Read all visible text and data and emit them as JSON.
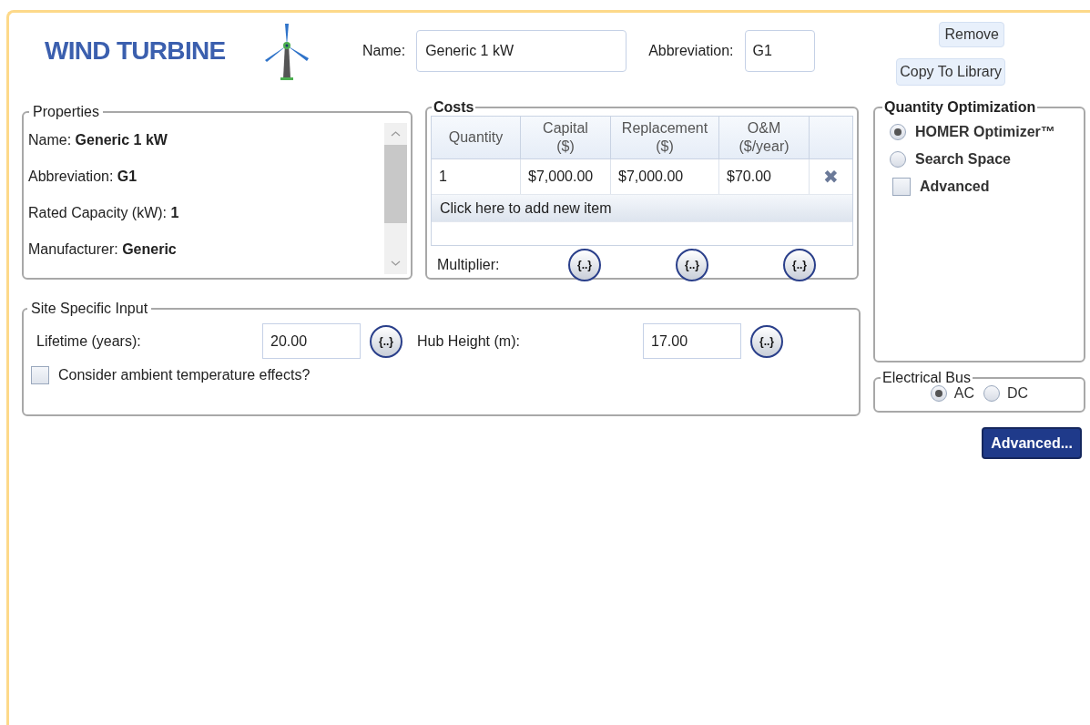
{
  "header": {
    "title": "WIND TURBINE",
    "name_label": "Name:",
    "name_value": "Generic 1 kW",
    "abbreviation_label": "Abbreviation:",
    "abbreviation_value": "G1"
  },
  "actions": {
    "remove": "Remove",
    "copy": "Copy To Library"
  },
  "properties": {
    "title": "Properties",
    "items": [
      "Name: **Generic 1 kW**",
      "Abbreviation: **G1**",
      "Rated Capacity (kW): **1**",
      "Manufacturer: **Generic**"
    ]
  },
  "costs": {
    "title": "Costs",
    "columns": [
      "Quantity",
      "Capital\n($)",
      "Replacement\n($)",
      "O&M\n($/year)"
    ],
    "rows": [
      {
        "cells": [
          "1",
          "$7,000.00",
          "$7,000.00",
          "$70.00"
        ],
        "delete": "✖"
      }
    ],
    "add_item": "Click here to add new item",
    "multiplier_label": "Multiplier:",
    "multipliers": [
      "{..}",
      "{..}",
      "{..}"
    ]
  },
  "quantity_optimization": {
    "title": "Quantity Optimization",
    "options": [
      {
        "kind": "radio",
        "label": "HOMER Optimizer™",
        "selected": true
      },
      {
        "kind": "radio",
        "label": "Search Space",
        "selected": false
      },
      {
        "kind": "checkbox",
        "label": "Advanced",
        "checked": false
      }
    ]
  },
  "site_specific": {
    "title": "Site Specific Input",
    "fields": [
      {
        "label": "Lifetime (years):",
        "value": "20.00",
        "multiplier": "{..}"
      },
      {
        "label": "Hub Height (m):",
        "value": "17.00",
        "multiplier": "{..}"
      }
    ],
    "ambient": {
      "label": "Consider ambient temperature effects?",
      "checked": false
    }
  },
  "electrical_bus": {
    "title": "Electrical Bus",
    "options": [
      {
        "label": "AC",
        "selected": true
      },
      {
        "label": "DC",
        "selected": false
      }
    ]
  },
  "advanced_button": "Advanced..."
}
